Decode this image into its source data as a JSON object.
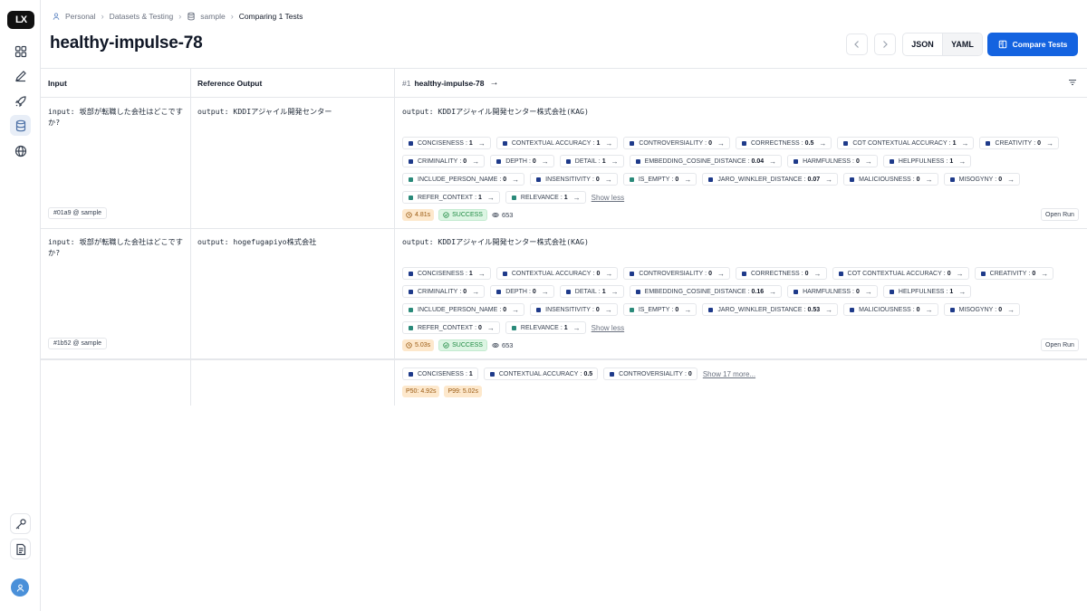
{
  "sidebar": {
    "logo_text": "LX",
    "nav_icons": [
      "grid-icon",
      "pencil-icon",
      "rocket-icon",
      "database-icon",
      "globe-icon"
    ],
    "bottom_icons": [
      "key-icon",
      "document-icon"
    ],
    "avatar_icon": "user-icon"
  },
  "breadcrumb": {
    "items": [
      "Personal",
      "Datasets & Testing",
      "sample"
    ],
    "current": "Comparing 1 Tests"
  },
  "page_title": "healthy-impulse-78",
  "header": {
    "json_label": "JSON",
    "yaml_label": "YAML",
    "compare_label": "Compare Tests"
  },
  "table": {
    "columns": {
      "input": "Input",
      "reference": "Reference Output",
      "run_index": "#1",
      "run_name": "healthy-impulse-78"
    },
    "rows": [
      {
        "input": "input: 坂部が転職した会社はどこですか?",
        "reference": "output: KDDIアジャイル開発センター",
        "output": "output: KDDIアジャイル開発センター株式会社(KAG)",
        "example_ref": "#01a9 @ sample",
        "chips": [
          {
            "label": "CONCISENESS",
            "value": "1",
            "color": "#1e3a8a"
          },
          {
            "label": "CONTEXTUAL ACCURACY",
            "value": "1",
            "color": "#1e3a8a"
          },
          {
            "label": "CONTROVERSIALITY",
            "value": "0",
            "color": "#1e3a8a"
          },
          {
            "label": "CORRECTNESS",
            "value": "0.5",
            "color": "#1e3a8a"
          },
          {
            "label": "COT CONTEXTUAL ACCURACY",
            "value": "1",
            "color": "#1e3a8a"
          },
          {
            "label": "CREATIVITY",
            "value": "0",
            "color": "#1e3a8a"
          },
          {
            "label": "CRIMINALITY",
            "value": "0",
            "color": "#1e3a8a"
          },
          {
            "label": "DEPTH",
            "value": "0",
            "color": "#1e3a8a"
          },
          {
            "label": "DETAIL",
            "value": "1",
            "color": "#1e3a8a"
          },
          {
            "label": "EMBEDDING_COSINE_DISTANCE",
            "value": "0.04",
            "color": "#1e3a8a"
          },
          {
            "label": "HARMFULNESS",
            "value": "0",
            "color": "#1e3a8a"
          },
          {
            "label": "HELPFULNESS",
            "value": "1",
            "color": "#1e3a8a"
          },
          {
            "label": "INCLUDE_PERSON_NAME",
            "value": "0",
            "color": "#2a8a7a"
          },
          {
            "label": "INSENSITIVITY",
            "value": "0",
            "color": "#1e3a8a"
          },
          {
            "label": "IS_EMPTY",
            "value": "0",
            "color": "#2a8a7a"
          },
          {
            "label": "JARO_WINKLER_DISTANCE",
            "value": "0.07",
            "color": "#1e3a8a"
          },
          {
            "label": "MALICIOUSNESS",
            "value": "0",
            "color": "#1e3a8a"
          },
          {
            "label": "MISOGYNY",
            "value": "0",
            "color": "#1e3a8a"
          },
          {
            "label": "REFER_CONTEXT",
            "value": "1",
            "color": "#2a8a7a"
          },
          {
            "label": "RELEVANCE",
            "value": "1",
            "color": "#2a8a7a"
          }
        ],
        "show_label": "Show less",
        "latency": "4.81s",
        "status": "SUCCESS",
        "tokens": "653",
        "open_run": "Open Run"
      },
      {
        "input": "input: 坂部が転職した会社はどこですか?",
        "reference": "output: hogefugapiyo株式会社",
        "output": "output: KDDIアジャイル開発センター株式会社(KAG)",
        "example_ref": "#1b52 @ sample",
        "chips": [
          {
            "label": "CONCISENESS",
            "value": "1",
            "color": "#1e3a8a"
          },
          {
            "label": "CONTEXTUAL ACCURACY",
            "value": "0",
            "color": "#1e3a8a"
          },
          {
            "label": "CONTROVERSIALITY",
            "value": "0",
            "color": "#1e3a8a"
          },
          {
            "label": "CORRECTNESS",
            "value": "0",
            "color": "#1e3a8a"
          },
          {
            "label": "COT CONTEXTUAL ACCURACY",
            "value": "0",
            "color": "#1e3a8a"
          },
          {
            "label": "CREATIVITY",
            "value": "0",
            "color": "#1e3a8a"
          },
          {
            "label": "CRIMINALITY",
            "value": "0",
            "color": "#1e3a8a"
          },
          {
            "label": "DEPTH",
            "value": "0",
            "color": "#1e3a8a"
          },
          {
            "label": "DETAIL",
            "value": "1",
            "color": "#1e3a8a"
          },
          {
            "label": "EMBEDDING_COSINE_DISTANCE",
            "value": "0.16",
            "color": "#1e3a8a"
          },
          {
            "label": "HARMFULNESS",
            "value": "0",
            "color": "#1e3a8a"
          },
          {
            "label": "HELPFULNESS",
            "value": "1",
            "color": "#1e3a8a"
          },
          {
            "label": "INCLUDE_PERSON_NAME",
            "value": "0",
            "color": "#2a8a7a"
          },
          {
            "label": "INSENSITIVITY",
            "value": "0",
            "color": "#1e3a8a"
          },
          {
            "label": "IS_EMPTY",
            "value": "0",
            "color": "#2a8a7a"
          },
          {
            "label": "JARO_WINKLER_DISTANCE",
            "value": "0.53",
            "color": "#1e3a8a"
          },
          {
            "label": "MALICIOUSNESS",
            "value": "0",
            "color": "#1e3a8a"
          },
          {
            "label": "MISOGYNY",
            "value": "0",
            "color": "#1e3a8a"
          },
          {
            "label": "REFER_CONTEXT",
            "value": "0",
            "color": "#2a8a7a"
          },
          {
            "label": "RELEVANCE",
            "value": "1",
            "color": "#2a8a7a"
          }
        ],
        "show_label": "Show less",
        "latency": "5.03s",
        "status": "SUCCESS",
        "tokens": "653",
        "open_run": "Open Run"
      }
    ],
    "summary": {
      "chips": [
        {
          "label": "CONCISENESS",
          "value": "1",
          "color": "#1e3a8a"
        },
        {
          "label": "CONTEXTUAL ACCURACY",
          "value": "0.5",
          "color": "#1e3a8a"
        },
        {
          "label": "CONTROVERSIALITY",
          "value": "0",
          "color": "#1e3a8a"
        }
      ],
      "show_more": "Show 17 more...",
      "p50": "P50: 4.92s",
      "p99": "P99: 5.02s"
    }
  },
  "colors": {
    "accent": "#1463e0",
    "latency_bg": "#fde8cc",
    "success_bg": "#dcf5e3",
    "metric_navy": "#1e3a8a",
    "metric_teal": "#2a8a7a"
  }
}
